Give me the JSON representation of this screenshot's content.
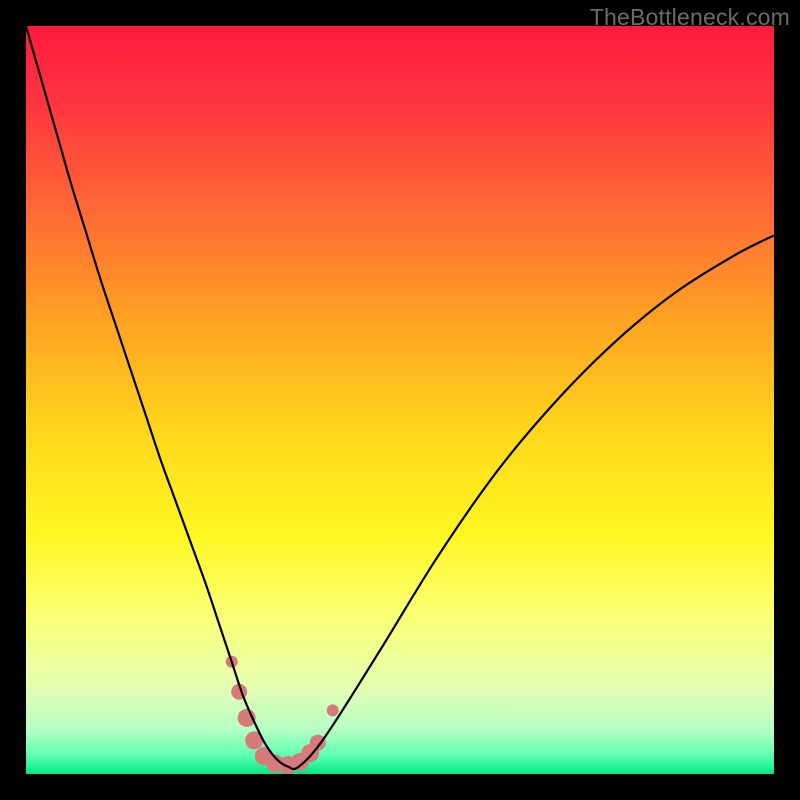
{
  "watermark": "TheBottleneck.com",
  "chart_data": {
    "type": "line",
    "title": "",
    "xlabel": "",
    "ylabel": "",
    "xlim": [
      0,
      100
    ],
    "ylim": [
      0,
      100
    ],
    "grid": false,
    "background_gradient": {
      "stops": [
        {
          "t": 0.0,
          "color": "#ff1a3c"
        },
        {
          "t": 0.1,
          "color": "#ff3440"
        },
        {
          "t": 0.25,
          "color": "#ff6a35"
        },
        {
          "t": 0.4,
          "color": "#ffa522"
        },
        {
          "t": 0.55,
          "color": "#ffd91b"
        },
        {
          "t": 0.68,
          "color": "#fff722"
        },
        {
          "t": 0.78,
          "color": "#fcff6e"
        },
        {
          "t": 0.88,
          "color": "#e6ffb0"
        },
        {
          "t": 0.94,
          "color": "#b6ffc5"
        },
        {
          "t": 0.975,
          "color": "#5fffb0"
        },
        {
          "t": 1.0,
          "color": "#00e884"
        }
      ]
    },
    "series": [
      {
        "name": "bottleneck-curve",
        "stroke": "#000000",
        "stroke_width": 2.2,
        "x": [
          0.0,
          2,
          4,
          6,
          8,
          10,
          12,
          14,
          16,
          18,
          20,
          22,
          24,
          26,
          27.5,
          29,
          30.5,
          32,
          33.5,
          35,
          36.5,
          40,
          47,
          55,
          63,
          71,
          79,
          87,
          95,
          100
        ],
        "y": [
          100,
          93,
          86,
          79,
          72.5,
          66,
          60,
          54,
          48,
          42,
          36.5,
          31,
          25.5,
          19.5,
          15,
          10.5,
          7,
          4,
          2,
          1,
          1,
          5,
          16,
          29,
          40.5,
          50,
          58,
          64.5,
          69.5,
          72
        ]
      }
    ],
    "markers": {
      "name": "highlighted-points",
      "color": "#d77a7a",
      "points": [
        {
          "x": 27.5,
          "y": 15,
          "r": 6
        },
        {
          "x": 28.5,
          "y": 11,
          "r": 8
        },
        {
          "x": 29.5,
          "y": 7.5,
          "r": 9
        },
        {
          "x": 30.5,
          "y": 4.5,
          "r": 9
        },
        {
          "x": 31.8,
          "y": 2.4,
          "r": 9
        },
        {
          "x": 33.3,
          "y": 1.4,
          "r": 9
        },
        {
          "x": 35.0,
          "y": 1.2,
          "r": 9
        },
        {
          "x": 36.6,
          "y": 1.6,
          "r": 9
        },
        {
          "x": 38.0,
          "y": 2.8,
          "r": 9
        },
        {
          "x": 39.0,
          "y": 4.2,
          "r": 8
        },
        {
          "x": 41.0,
          "y": 8.5,
          "r": 6
        }
      ]
    }
  }
}
